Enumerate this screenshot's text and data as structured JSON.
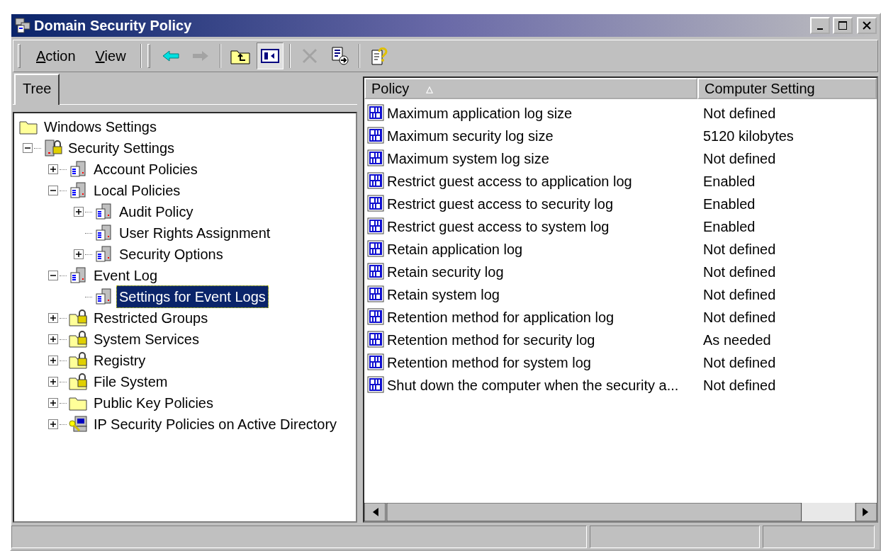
{
  "window": {
    "title": "Domain Security Policy"
  },
  "menus": [
    {
      "label": "Action"
    },
    {
      "label": "View"
    }
  ],
  "toolbar": [
    {
      "kind": "back",
      "disabled": false,
      "selected": false
    },
    {
      "kind": "forward",
      "disabled": true,
      "selected": false
    },
    {
      "kind": "up",
      "disabled": false,
      "selected": false
    },
    {
      "kind": "tree-toggle",
      "disabled": false,
      "selected": true
    },
    {
      "kind": "delete",
      "disabled": true,
      "selected": false
    },
    {
      "kind": "export",
      "disabled": false,
      "selected": false
    },
    {
      "kind": "help",
      "disabled": false,
      "selected": false
    }
  ],
  "tabs": [
    {
      "label": "Tree",
      "selected": true
    }
  ],
  "tree": [
    {
      "label": "Windows Settings",
      "kind": "folder",
      "selected": false,
      "children": [
        {
          "label": "Security Settings",
          "kind": "lock-server",
          "selected": false,
          "expanded": true,
          "children": [
            {
              "label": "Account Policies",
              "kind": "server",
              "selected": false,
              "expanded": false
            },
            {
              "label": "Local Policies",
              "kind": "server",
              "selected": false,
              "expanded": true,
              "children": [
                {
                  "label": "Audit Policy",
                  "kind": "server",
                  "selected": false,
                  "expanded": false
                },
                {
                  "label": "User Rights Assignment",
                  "kind": "server",
                  "selected": false
                },
                {
                  "label": "Security Options",
                  "kind": "server",
                  "selected": false,
                  "expanded": false
                }
              ]
            },
            {
              "label": "Event Log",
              "kind": "server",
              "selected": false,
              "expanded": true,
              "children": [
                {
                  "label": "Settings for Event Logs",
                  "kind": "server",
                  "selected": true
                }
              ]
            },
            {
              "label": "Restricted Groups",
              "kind": "lock-folder",
              "selected": false,
              "expanded": false
            },
            {
              "label": "System Services",
              "kind": "lock-folder",
              "selected": false,
              "expanded": false
            },
            {
              "label": "Registry",
              "kind": "lock-folder",
              "selected": false,
              "expanded": false
            },
            {
              "label": "File System",
              "kind": "lock-folder",
              "selected": false,
              "expanded": false
            },
            {
              "label": "Public Key Policies",
              "kind": "folder",
              "selected": false,
              "expanded": false
            },
            {
              "label": "IP Security Policies on Active Directory",
              "kind": "ip",
              "selected": false,
              "expanded": false
            }
          ]
        }
      ]
    }
  ],
  "table": {
    "columns": [
      {
        "label": "Policy",
        "sort_indicator": "▵"
      },
      {
        "label": "Computer Setting"
      }
    ],
    "rows": [
      {
        "policy": "Maximum application log size",
        "setting": "Not defined"
      },
      {
        "policy": "Maximum security log size",
        "setting": "5120 kilobytes"
      },
      {
        "policy": "Maximum system log size",
        "setting": "Not defined"
      },
      {
        "policy": "Restrict guest access to application log",
        "setting": "Enabled"
      },
      {
        "policy": "Restrict guest access to security log",
        "setting": "Enabled"
      },
      {
        "policy": "Restrict guest access to system log",
        "setting": "Enabled"
      },
      {
        "policy": "Retain application log",
        "setting": "Not defined"
      },
      {
        "policy": "Retain security log",
        "setting": "Not defined"
      },
      {
        "policy": "Retain system log",
        "setting": "Not defined"
      },
      {
        "policy": "Retention method for application log",
        "setting": "Not defined"
      },
      {
        "policy": "Retention method for security log",
        "setting": "As needed"
      },
      {
        "policy": "Retention method for system log",
        "setting": "Not defined"
      },
      {
        "policy": "Shut down the computer when the security a...",
        "setting": "Not defined"
      }
    ]
  }
}
